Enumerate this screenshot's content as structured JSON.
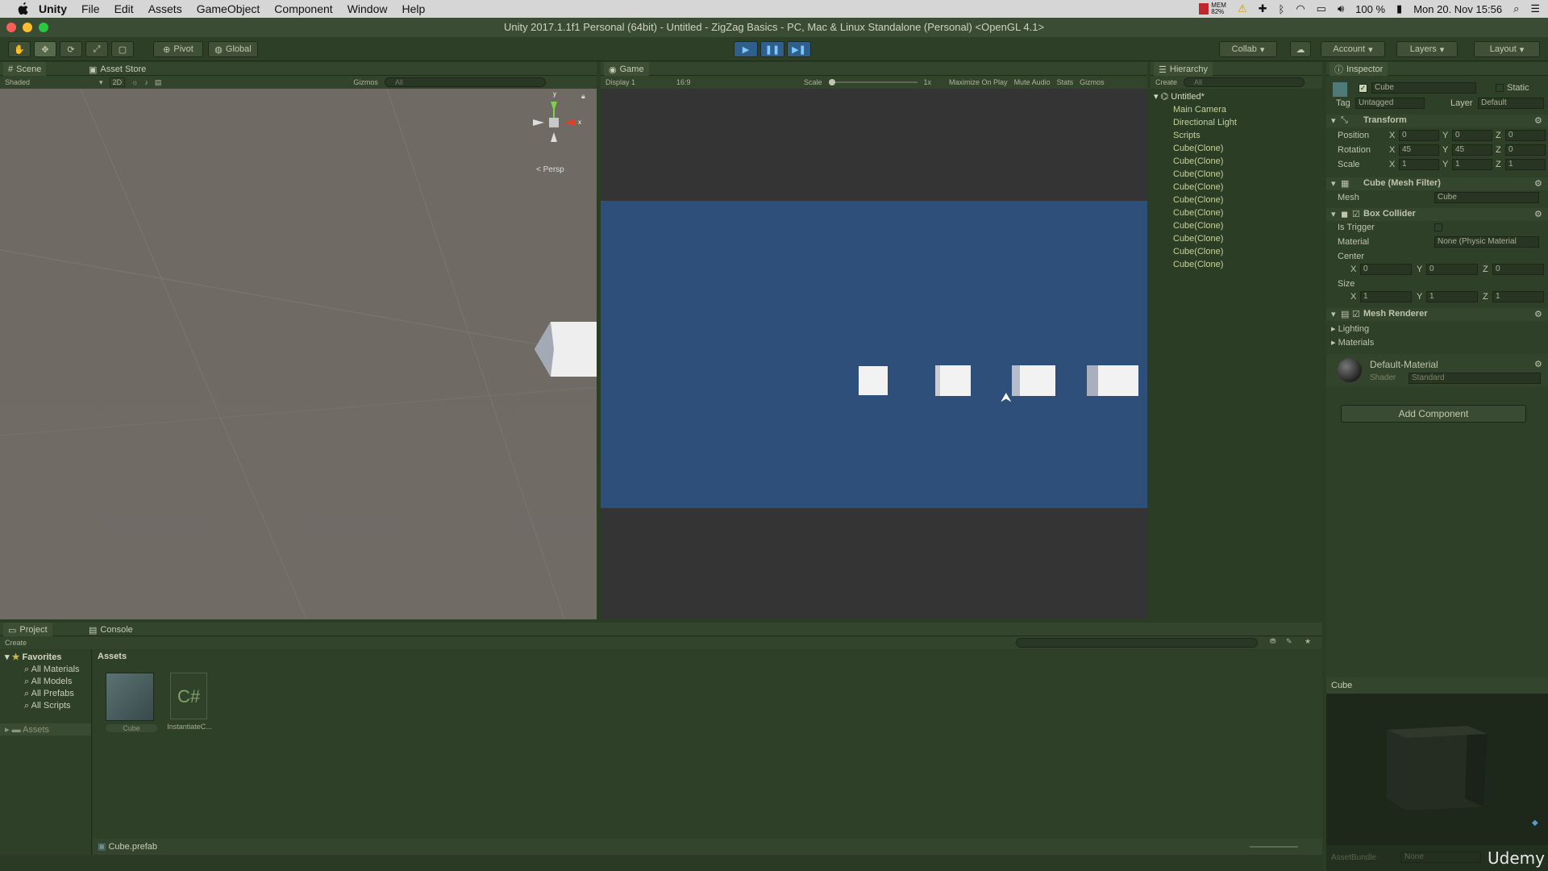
{
  "menubar": {
    "app": "Unity",
    "items": [
      "File",
      "Edit",
      "Assets",
      "GameObject",
      "Component",
      "Window",
      "Help"
    ],
    "mem_label": "MEM",
    "mem_value": "82%",
    "battery": "100 %",
    "datetime": "Mon 20. Nov  15:56"
  },
  "window_title": "Unity 2017.1.1f1 Personal (64bit) - Untitled - ZigZag Basics - PC, Mac & Linux Standalone (Personal) <OpenGL 4.1>",
  "toolbar": {
    "pivot": "Pivot",
    "global": "Global",
    "collab": "Collab",
    "account": "Account",
    "layers": "Layers",
    "layout": "Layout"
  },
  "scene": {
    "tab": "Scene",
    "tab2": "Asset Store",
    "shading": "Shaded",
    "mode_2d": "2D",
    "gizmos": "Gizmos",
    "search_placeholder": "All",
    "gizmo_y": "y",
    "gizmo_x": "x",
    "persp": "< Persp"
  },
  "game": {
    "tab": "Game",
    "display": "Display 1",
    "aspect": "16:9",
    "scale_label": "Scale",
    "scale_value": "1x",
    "maximize": "Maximize On Play",
    "mute": "Mute Audio",
    "stats": "Stats",
    "gizmos": "Gizmos"
  },
  "hierarchy": {
    "tab": "Hierarchy",
    "create": "Create",
    "search_placeholder": "All",
    "scene": "Untitled*",
    "items": [
      "Main Camera",
      "Directional Light",
      "Scripts",
      "Cube(Clone)",
      "Cube(Clone)",
      "Cube(Clone)",
      "Cube(Clone)",
      "Cube(Clone)",
      "Cube(Clone)",
      "Cube(Clone)",
      "Cube(Clone)",
      "Cube(Clone)",
      "Cube(Clone)"
    ]
  },
  "inspector": {
    "tab": "Inspector",
    "name": "Cube",
    "static": "Static",
    "tag_label": "Tag",
    "tag": "Untagged",
    "layer_label": "Layer",
    "layer": "Default",
    "transform": "Transform",
    "position": "Position",
    "rotation": "Rotation",
    "scale": "Scale",
    "pos": [
      "0",
      "0",
      "0"
    ],
    "rot": [
      "45",
      "45",
      "0"
    ],
    "scl": [
      "1",
      "1",
      "1"
    ],
    "axis_x": "X",
    "axis_y": "Y",
    "axis_z": "Z",
    "mesh_filter": "Cube (Mesh Filter)",
    "mesh_label": "Mesh",
    "mesh": "Cube",
    "box_collider": "Box Collider",
    "is_trigger": "Is Trigger",
    "material_label": "Material",
    "material": "None (Physic Material",
    "center": "Center",
    "center_vals": [
      "0",
      "0",
      "0"
    ],
    "size": "Size",
    "size_vals": [
      "1",
      "1",
      "1"
    ],
    "mesh_renderer": "Mesh Renderer",
    "lighting": "Lighting",
    "materials": "Materials",
    "default_material": "Default-Material",
    "shader_label": "Shader",
    "shader": "Standard",
    "add_component": "Add Component"
  },
  "project": {
    "tab": "Project",
    "tab2": "Console",
    "create": "Create",
    "favorites": "Favorites",
    "fav_items": [
      "All Materials",
      "All Models",
      "All Prefabs",
      "All Scripts"
    ],
    "assets_folder": "Assets",
    "assets_header": "Assets",
    "asset1": "Cube",
    "asset2": "InstantiateC...",
    "status": "Cube.prefab"
  },
  "preview": {
    "title": "Cube",
    "assetbundle": "AssetBundle",
    "assetbundle_value": "None"
  },
  "watermark": "Udemy"
}
